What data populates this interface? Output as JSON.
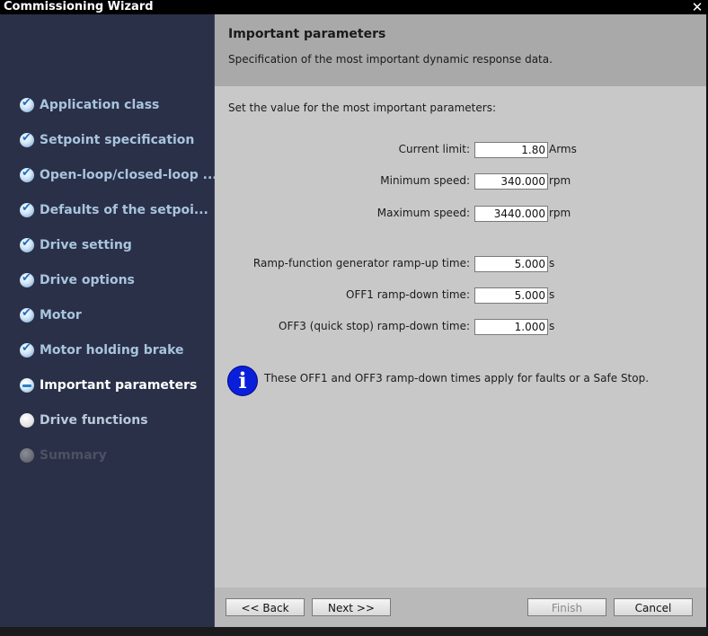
{
  "window": {
    "title": "Commissioning Wizard",
    "close_glyph": "✕"
  },
  "sidebar": {
    "steps": [
      {
        "label": "Application class",
        "state": "done"
      },
      {
        "label": "Setpoint specification",
        "state": "done"
      },
      {
        "label": "Open-loop/closed-loop ...",
        "state": "done"
      },
      {
        "label": "Defaults of the setpoi...",
        "state": "done"
      },
      {
        "label": "Drive setting",
        "state": "done"
      },
      {
        "label": "Drive options",
        "state": "done"
      },
      {
        "label": "Motor",
        "state": "done"
      },
      {
        "label": "Motor holding brake",
        "state": "done"
      },
      {
        "label": "Important parameters",
        "state": "current"
      },
      {
        "label": "Drive functions",
        "state": "pending"
      },
      {
        "label": "Summary",
        "state": "disabled"
      }
    ]
  },
  "header": {
    "title": "Important parameters",
    "subtitle": "Specification of the most important dynamic response data."
  },
  "main": {
    "intro": "Set the value for the most important parameters:",
    "parameters": [
      {
        "label": "Current limit:",
        "value": "1.80",
        "unit": "Arms"
      },
      {
        "label": "Minimum speed:",
        "value": "340.000",
        "unit": "rpm"
      },
      {
        "label": "Maximum speed:",
        "value": "3440.000",
        "unit": "rpm"
      },
      {
        "label": "Ramp-function generator ramp-up time:",
        "value": "5.000",
        "unit": "s"
      },
      {
        "label": "OFF1 ramp-down time:",
        "value": "5.000",
        "unit": "s"
      },
      {
        "label": "OFF3 (quick stop) ramp-down time:",
        "value": "1.000",
        "unit": "s"
      }
    ],
    "info_icon": "info-icon",
    "info_text": "These OFF1 and OFF3 ramp-down times apply for faults or a Safe Stop."
  },
  "footer": {
    "back_label": "<< Back",
    "next_label": "Next >>",
    "finish_label": "Finish",
    "cancel_label": "Cancel"
  },
  "colors": {
    "sidebar_bg": "#2a3047",
    "header_bg": "#a9a9a9",
    "content_bg": "#c8c8c8",
    "info_blue": "#0a1fd9",
    "step_text": "#a8c4de"
  }
}
